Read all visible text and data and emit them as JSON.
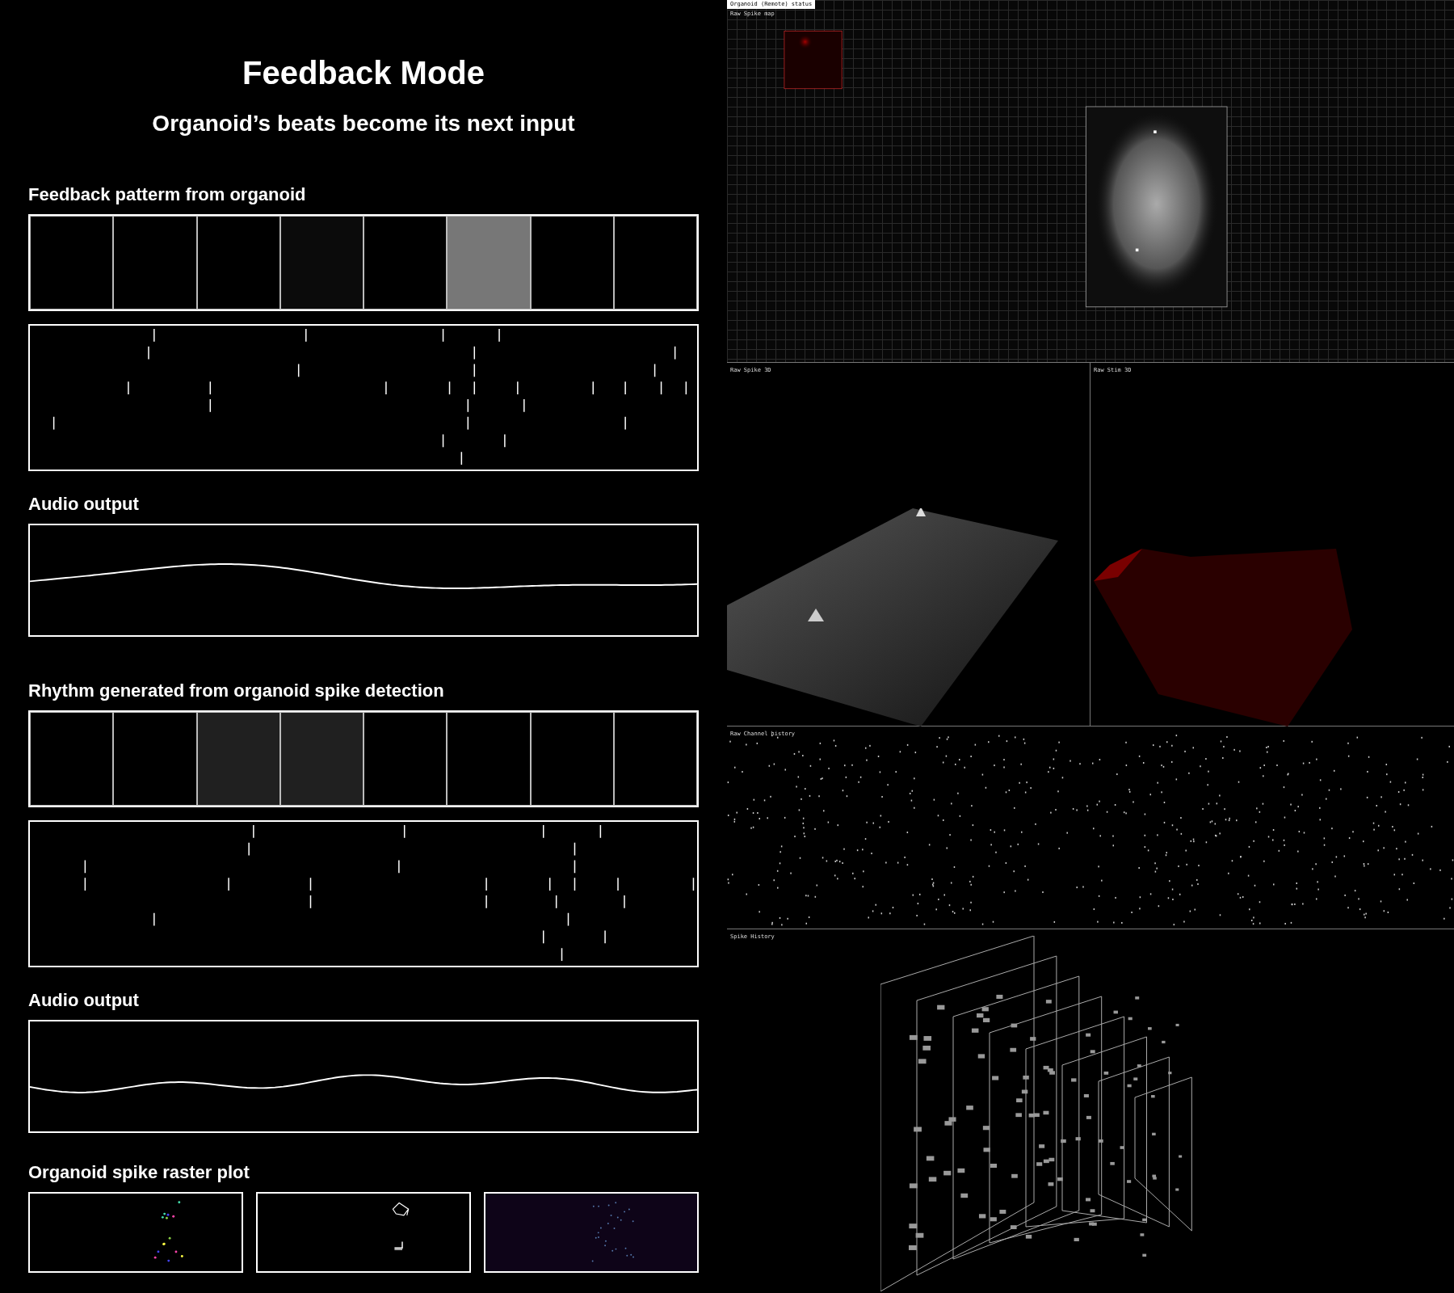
{
  "title": "Feedback Mode",
  "subtitle": "Organoid’s beats become its next input",
  "sections": [
    {
      "label": "Feedback patterm from organoid",
      "audio_label": "Audio output",
      "steps": [
        {
          "color": "#000000"
        },
        {
          "color": "#000000"
        },
        {
          "color": "#000000"
        },
        {
          "color": "#0b0b0b"
        },
        {
          "color": "#000000"
        },
        {
          "color": "#777777"
        },
        {
          "color": "#000000"
        },
        {
          "color": "#000000"
        }
      ]
    },
    {
      "label": "Rhythm generated from organoid spike detection",
      "audio_label": "Audio output",
      "steps": [
        {
          "color": "#000000"
        },
        {
          "color": "#000000"
        },
        {
          "color": "#202020"
        },
        {
          "color": "#202020"
        },
        {
          "color": "#000000"
        },
        {
          "color": "#000000"
        },
        {
          "color": "#000000"
        },
        {
          "color": "#000000"
        }
      ]
    }
  ],
  "raster_label": "Organoid spike raster plot",
  "monitor": {
    "status_title": "Organoid (Remote) status",
    "spike_map_label": "Raw Spike map",
    "spike_3d_label": "Raw Spike 3D",
    "stim_3d_label": "Raw Stim 3D",
    "channel_history_label": "Raw Channel history",
    "spike_history_label": "Spike History"
  }
}
